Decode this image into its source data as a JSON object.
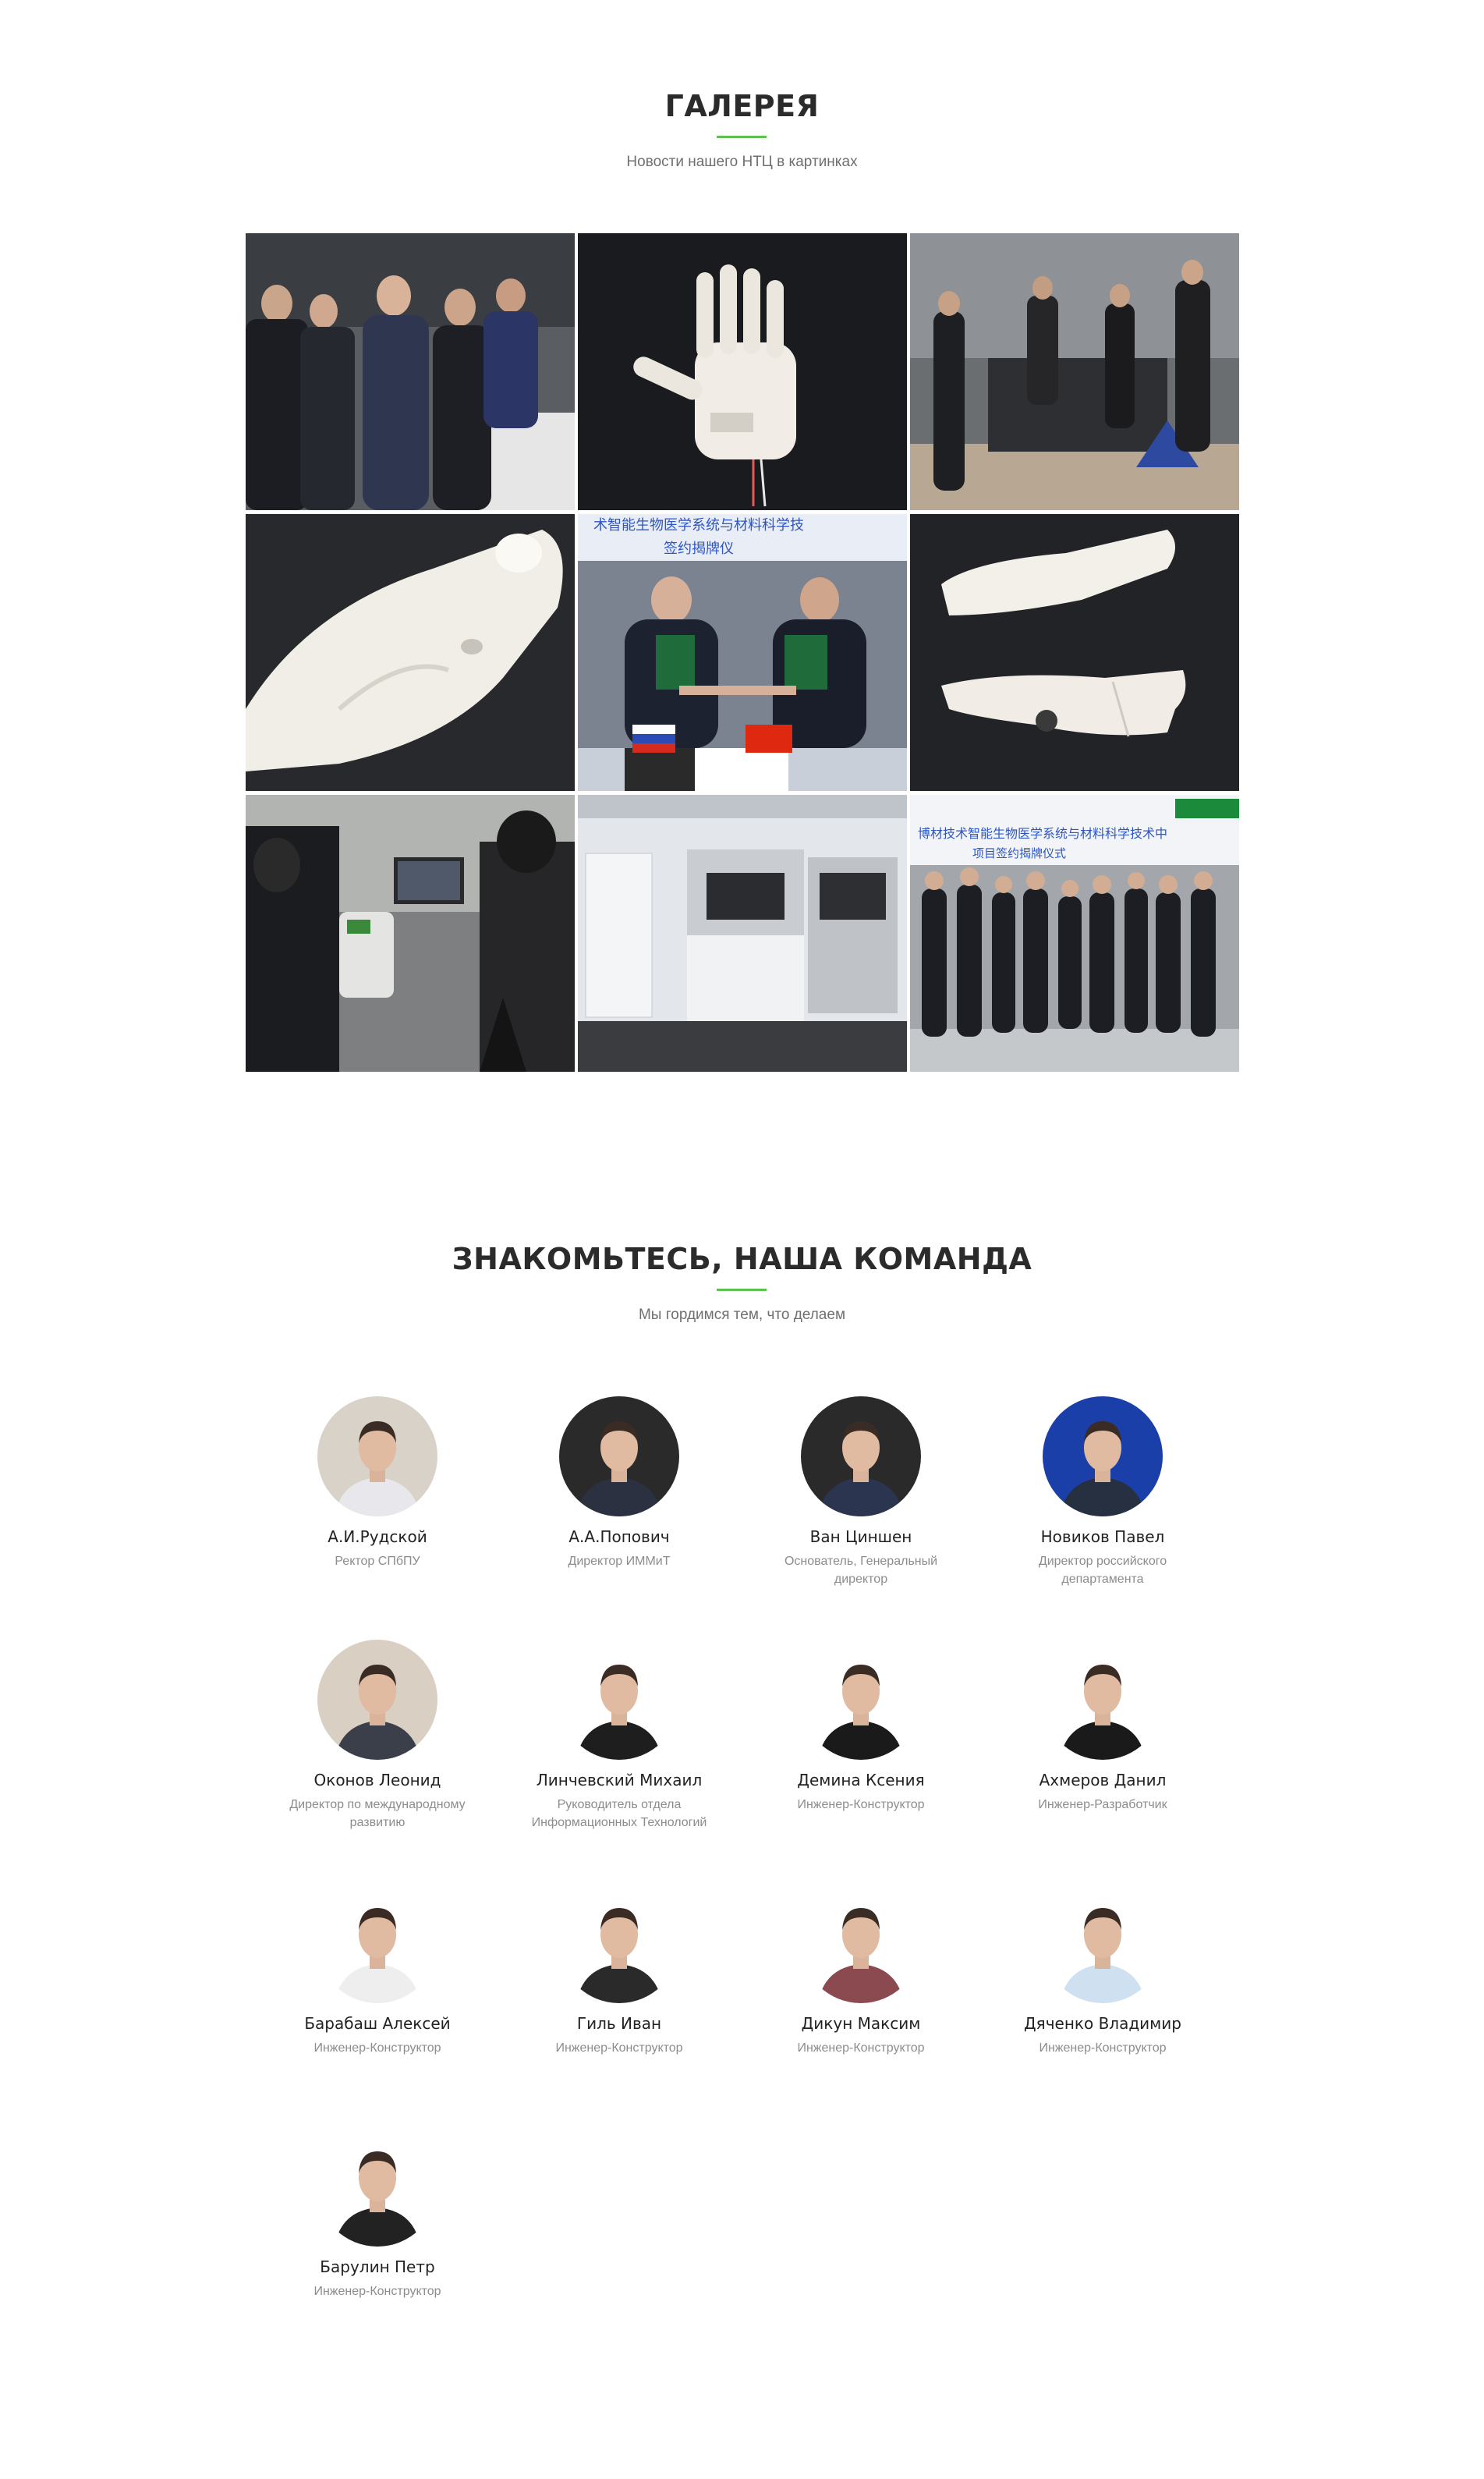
{
  "gallery": {
    "title": "ГАЛЕРЕЯ",
    "subtitle": "Новости нашего НТЦ в картинках",
    "images": [
      {
        "name": "gallery-photo-delegation"
      },
      {
        "name": "gallery-photo-prosthetic-hand"
      },
      {
        "name": "gallery-photo-lab-team"
      },
      {
        "name": "gallery-photo-3d-printed-part"
      },
      {
        "name": "gallery-photo-signing-ceremony"
      },
      {
        "name": "gallery-photo-orthosis"
      },
      {
        "name": "gallery-photo-3d-scanning"
      },
      {
        "name": "gallery-photo-3d-printer"
      },
      {
        "name": "gallery-photo-group-photo"
      }
    ]
  },
  "team": {
    "title": "ЗНАКОМЬТЕСЬ, НАША КОМАНДА",
    "subtitle": "Мы гордимся тем, что делаем",
    "members": [
      {
        "name": "А.И.Рудской",
        "role": "Ректор СПбПУ",
        "bg": "#d8d2c8",
        "shirt": "#e8e8ec"
      },
      {
        "name": "А.А.Попович",
        "role": "Директор ИММиТ",
        "bg": "#2a2a2a",
        "shirt": "#2c3142"
      },
      {
        "name": "Ван Циншен",
        "role": "Основатель, Генеральный директор",
        "bg": "#2a2a2a",
        "shirt": "#2b3550"
      },
      {
        "name": "Новиков Павел",
        "role": "Директор российского департамента",
        "bg": "#1b3fa8",
        "shirt": "#263040"
      },
      {
        "name": "Оконов Леонид",
        "role": "Директор по международному развитию",
        "bg": "#d9cfc2",
        "shirt": "#3a3f4a"
      },
      {
        "name": "Линчевский Михаил",
        "role": "Руководитель отдела Информационных Технологий",
        "bg": "#ffffff",
        "shirt": "#1e1e1e"
      },
      {
        "name": "Демина Ксения",
        "role": "Инженер-Конструктор",
        "bg": "#ffffff",
        "shirt": "#1a1a1a"
      },
      {
        "name": "Ахмеров Данил",
        "role": "Инженер-Разработчик",
        "bg": "#ffffff",
        "shirt": "#1a1a1a"
      },
      {
        "name": "Барабаш Алексей",
        "role": "Инженер-Конструктор",
        "bg": "#ffffff",
        "shirt": "#eeeeee"
      },
      {
        "name": "Гиль Иван",
        "role": "Инженер-Конструктор",
        "bg": "#ffffff",
        "shirt": "#2a2a2a"
      },
      {
        "name": "Дикун Максим",
        "role": "Инженер-Конструктор",
        "bg": "#ffffff",
        "shirt": "#8a4a4f"
      },
      {
        "name": "Дяченко Владимир",
        "role": "Инженер-Конструктор",
        "bg": "#ffffff",
        "shirt": "#cfe0f0"
      },
      {
        "name": "Барулин Петр",
        "role": "Инженер-Конструктор",
        "bg": "#ffffff",
        "shirt": "#222222"
      }
    ]
  },
  "colors": {
    "accent": "#5cc24e",
    "title": "#2b2b2b",
    "muted": "#8c8c8c"
  }
}
